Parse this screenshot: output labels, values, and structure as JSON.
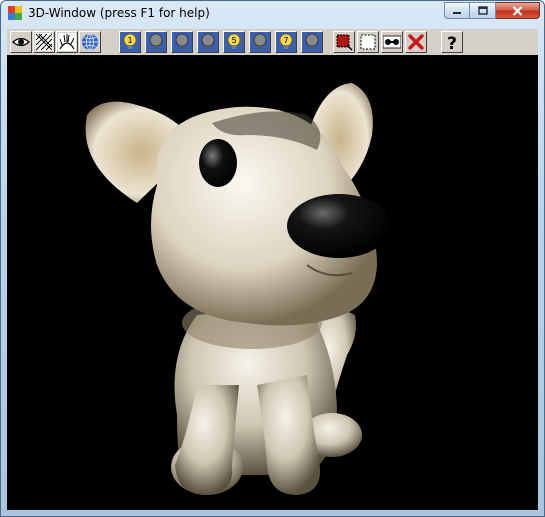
{
  "window": {
    "title": "3D-Window (press F1 for help)",
    "accent_color": "#aac4e0",
    "close_color": "#c1331b",
    "caption_buttons": [
      "minimize-icon",
      "maximize-icon",
      "close-icon"
    ]
  },
  "toolbar": {
    "tools": [
      {
        "id": "eye",
        "icon": "eye-icon"
      },
      {
        "id": "wireframe",
        "icon": "wireframe-icon"
      },
      {
        "id": "normals",
        "icon": "normals-icon"
      },
      {
        "id": "globe",
        "icon": "globe-icon"
      },
      {
        "id": "light1",
        "icon": "bulb-icon",
        "label": "1"
      },
      {
        "id": "light2",
        "icon": "bulb-icon"
      },
      {
        "id": "light3",
        "icon": "bulb-icon"
      },
      {
        "id": "light4",
        "icon": "bulb-icon"
      },
      {
        "id": "light5",
        "icon": "bulb-icon",
        "label": "5"
      },
      {
        "id": "light6",
        "icon": "bulb-icon"
      },
      {
        "id": "light7",
        "icon": "bulb-icon",
        "label": "7"
      },
      {
        "id": "light8",
        "icon": "bulb-icon"
      },
      {
        "id": "select-region",
        "icon": "select-region-icon"
      },
      {
        "id": "select-box",
        "icon": "select-box-icon"
      },
      {
        "id": "points",
        "icon": "points-icon"
      },
      {
        "id": "delete",
        "icon": "delete-icon"
      },
      {
        "id": "help",
        "icon": "help-icon",
        "label": "?"
      }
    ]
  },
  "viewport": {
    "background": "#000000",
    "content": "textured 3D dog figurine model"
  }
}
